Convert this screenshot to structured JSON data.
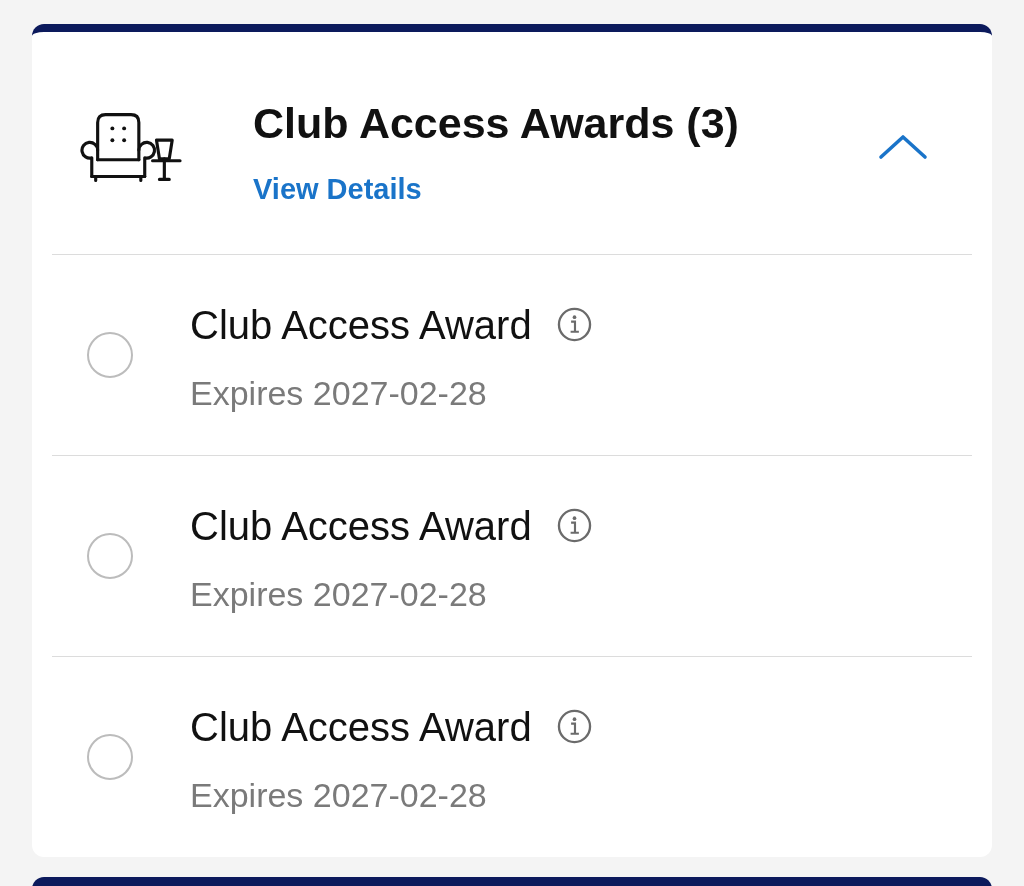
{
  "card": {
    "title": "Club Access Awards (3)",
    "link": "View Details",
    "expanded": true,
    "awards": [
      {
        "name": "Club Access Award",
        "expires": "Expires 2027-02-28",
        "selected": false
      },
      {
        "name": "Club Access Award",
        "expires": "Expires 2027-02-28",
        "selected": false
      },
      {
        "name": "Club Access Award",
        "expires": "Expires 2027-02-28",
        "selected": false
      }
    ]
  }
}
